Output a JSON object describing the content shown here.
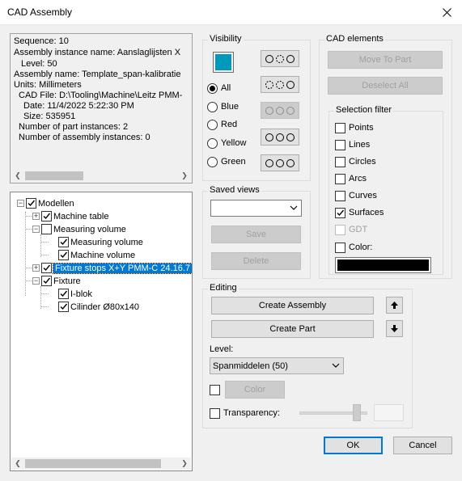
{
  "window": {
    "title": "CAD Assembly"
  },
  "info": {
    "lines": [
      "Sequence: 10",
      "Assembly instance name: Aanslaglijsten X",
      "Level: 50",
      "Assembly name: Template_span-kalibratie",
      "Units: Millimeters",
      "CAD File: D:\\Tooling\\Machine\\Leitz PMM-",
      "Date: 11/4/2022 5:22:30 PM",
      "Size: 535951",
      "Number of part instances: 2",
      "Number of assembly instances: 0"
    ]
  },
  "tree": {
    "items": [
      {
        "label": "Modellen",
        "checked": true
      },
      {
        "label": "Machine table",
        "checked": true
      },
      {
        "label": "Measuring volume",
        "checked": false
      },
      {
        "label": "Measuring volume",
        "checked": true
      },
      {
        "label": "Machine volume",
        "checked": true
      },
      {
        "label": "Fixture stops X+Y PMM-C 24.16.7",
        "checked": true
      },
      {
        "label": "Fixture",
        "checked": true
      },
      {
        "label": "I-blok",
        "checked": true
      },
      {
        "label": "Cilinder Ø80x140",
        "checked": true
      }
    ]
  },
  "visibility": {
    "label": "Visibility",
    "swatch_color": "#0099bc",
    "radios": [
      {
        "label": "All",
        "selected": true
      },
      {
        "label": "Blue",
        "selected": false
      },
      {
        "label": "Red",
        "selected": false
      },
      {
        "label": "Yellow",
        "selected": false
      },
      {
        "label": "Green",
        "selected": false
      }
    ]
  },
  "saved_views": {
    "label": "Saved views",
    "dropdown_value": "",
    "save_label": "Save",
    "delete_label": "Delete"
  },
  "cad_elements": {
    "label": "CAD elements",
    "move_to_part_label": "Move To Part",
    "deselect_all_label": "Deselect All"
  },
  "selection_filter": {
    "label": "Selection filter",
    "items": [
      {
        "label": "Points",
        "checked": false
      },
      {
        "label": "Lines",
        "checked": false
      },
      {
        "label": "Circles",
        "checked": false
      },
      {
        "label": "Arcs",
        "checked": false
      },
      {
        "label": "Curves",
        "checked": false
      },
      {
        "label": "Surfaces",
        "checked": true
      },
      {
        "label": "GDT",
        "checked": false,
        "disabled": true
      },
      {
        "label": "Color:",
        "checked": false
      }
    ],
    "color_swatch": "#000000"
  },
  "editing": {
    "label": "Editing",
    "create_assembly_label": "Create Assembly",
    "create_part_label": "Create Part",
    "level_label": "Level:",
    "level_value": "Spanmiddelen (50)",
    "color_button_label": "Color",
    "transparency_label": "Transparency:"
  },
  "footer": {
    "ok_label": "OK",
    "cancel_label": "Cancel"
  }
}
